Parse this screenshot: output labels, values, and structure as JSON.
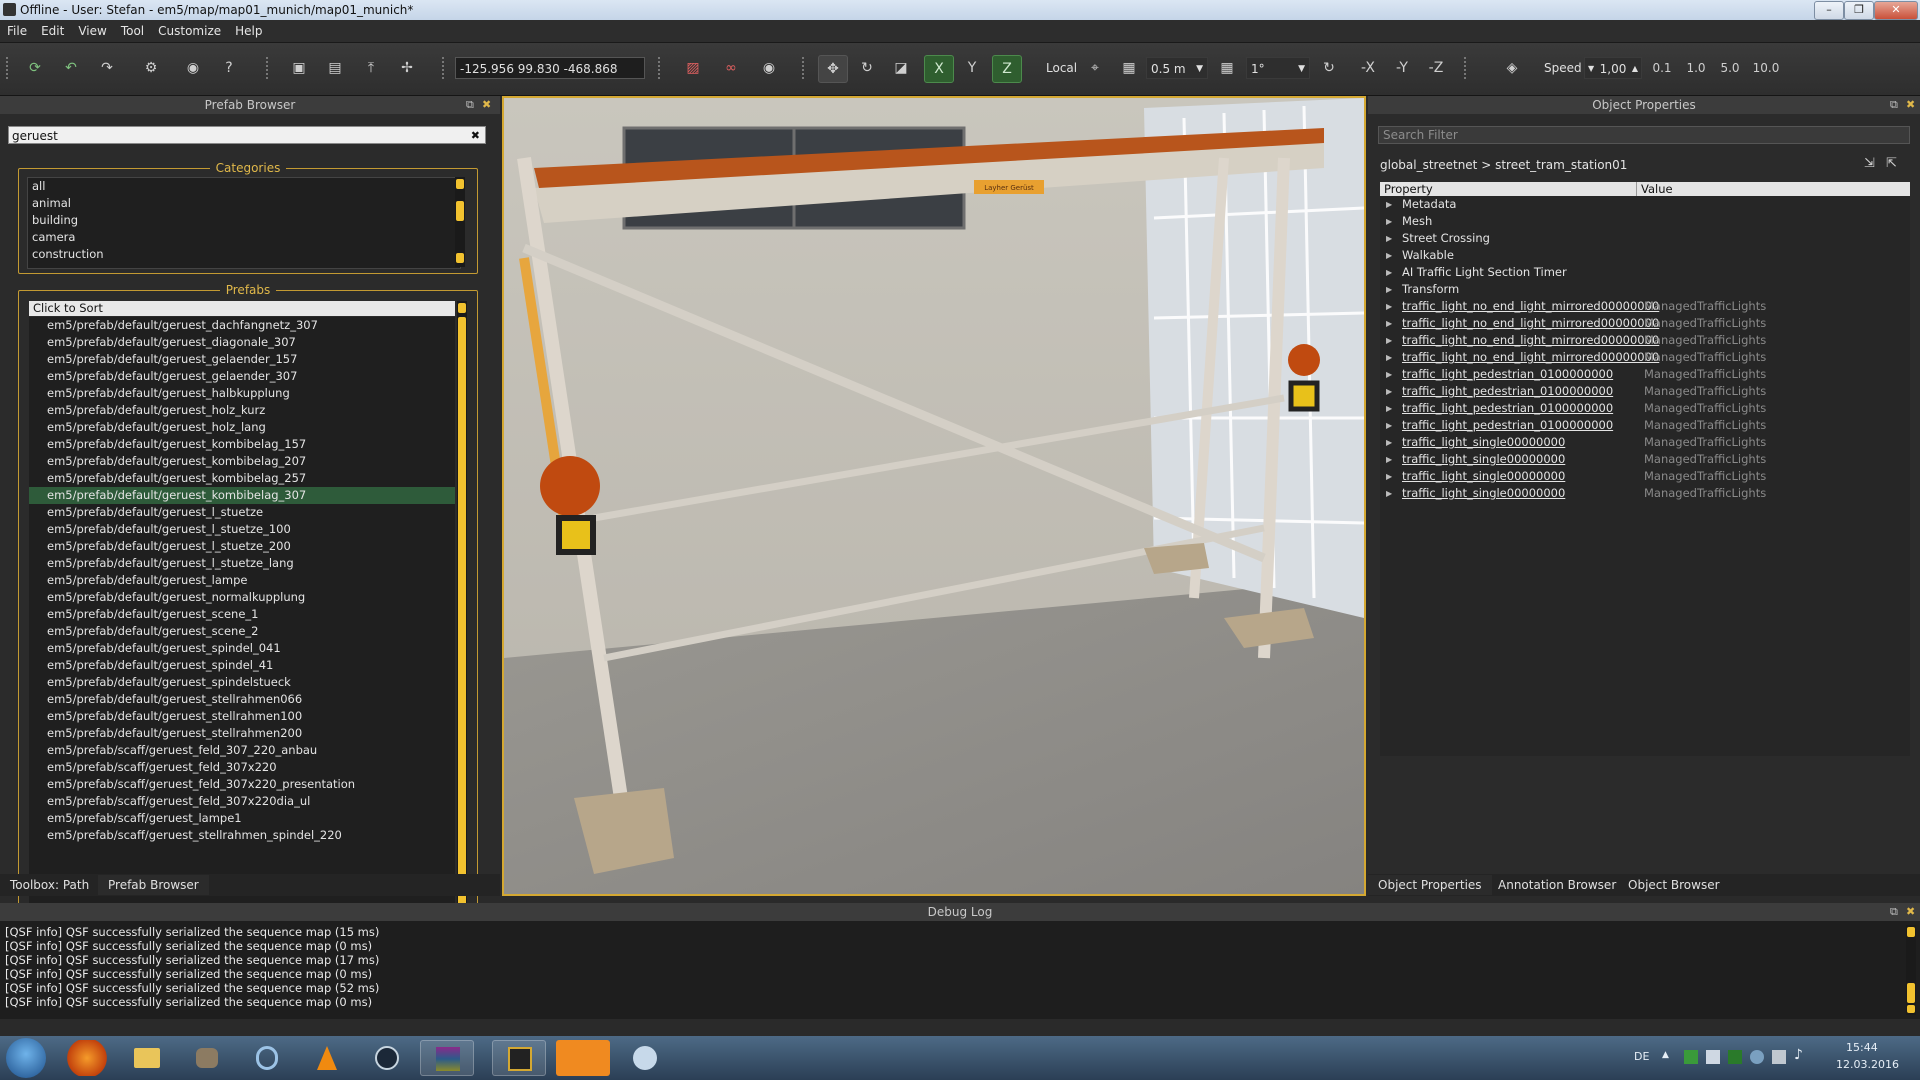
{
  "window": {
    "title": "Offline - User: Stefan - em5/map/map01_munich/map01_munich*",
    "min": "–",
    "max": "❐",
    "close": "✕"
  },
  "menu": [
    "File",
    "Edit",
    "View",
    "Tool",
    "Customize",
    "Help"
  ],
  "toolbar": {
    "coords": "-125.956 99.830 -468.868",
    "axis_x": "X",
    "axis_y": "Y",
    "axis_z": "Z",
    "local_label": "Local",
    "grid_size": "0.5 m",
    "angle_snap": "1°",
    "neg_x": "-X",
    "neg_y": "-Y",
    "neg_z": "-Z",
    "speed_label": "Speed",
    "speed_value": "1,00",
    "speed_presets": [
      "0.1",
      "1.0",
      "5.0",
      "10.0"
    ]
  },
  "prefab_browser": {
    "header": "Prefab Browser",
    "search_value": "geruest",
    "categories_title": "Categories",
    "categories": [
      "all",
      "animal",
      "building",
      "camera",
      "construction"
    ],
    "prefabs_title": "Prefabs",
    "sort_label": "Click to Sort",
    "selected_index": 10,
    "prefabs": [
      "em5/prefab/default/geruest_dachfangnetz_307",
      "em5/prefab/default/geruest_diagonale_307",
      "em5/prefab/default/geruest_gelaender_157",
      "em5/prefab/default/geruest_gelaender_307",
      "em5/prefab/default/geruest_halbkupplung",
      "em5/prefab/default/geruest_holz_kurz",
      "em5/prefab/default/geruest_holz_lang",
      "em5/prefab/default/geruest_kombibelag_157",
      "em5/prefab/default/geruest_kombibelag_207",
      "em5/prefab/default/geruest_kombibelag_257",
      "em5/prefab/default/geruest_kombibelag_307",
      "em5/prefab/default/geruest_l_stuetze",
      "em5/prefab/default/geruest_l_stuetze_100",
      "em5/prefab/default/geruest_l_stuetze_200",
      "em5/prefab/default/geruest_l_stuetze_lang",
      "em5/prefab/default/geruest_lampe",
      "em5/prefab/default/geruest_normalkupplung",
      "em5/prefab/default/geruest_scene_1",
      "em5/prefab/default/geruest_scene_2",
      "em5/prefab/default/geruest_spindel_041",
      "em5/prefab/default/geruest_spindel_41",
      "em5/prefab/default/geruest_spindelstueck",
      "em5/prefab/default/geruest_stellrahmen066",
      "em5/prefab/default/geruest_stellrahmen100",
      "em5/prefab/default/geruest_stellrahmen200",
      "em5/prefab/scaff/geruest_feld_307_220_anbau",
      "em5/prefab/scaff/geruest_feld_307x220",
      "em5/prefab/scaff/geruest_feld_307x220_presentation",
      "em5/prefab/scaff/geruest_feld_307x220dia_ul",
      "em5/prefab/scaff/geruest_lampe1",
      "em5/prefab/scaff/geruest_stellrahmen_spindel_220"
    ],
    "bottom_tabs": [
      "Toolbox: Path",
      "Prefab Browser"
    ]
  },
  "viewport": {
    "sign_text": "Layher Gerüst"
  },
  "object_properties": {
    "header": "Object Properties",
    "search_placeholder": "Search Filter",
    "breadcrumb": "global_streetnet > street_tram_station01",
    "col_property": "Property",
    "col_value": "Value",
    "groups": [
      "Metadata",
      "Mesh",
      "Street Crossing",
      "Walkable",
      "AI Traffic Light Section Timer",
      "Transform"
    ],
    "components": [
      {
        "name": "traffic_light_no_end_light_mirrored00000000",
        "value": "ManagedTrafficLights"
      },
      {
        "name": "traffic_light_no_end_light_mirrored00000000",
        "value": "ManagedTrafficLights"
      },
      {
        "name": "traffic_light_no_end_light_mirrored00000000",
        "value": "ManagedTrafficLights"
      },
      {
        "name": "traffic_light_no_end_light_mirrored00000000",
        "value": "ManagedTrafficLights"
      },
      {
        "name": "traffic_light_pedestrian_0100000000",
        "value": "ManagedTrafficLights"
      },
      {
        "name": "traffic_light_pedestrian_0100000000",
        "value": "ManagedTrafficLights"
      },
      {
        "name": "traffic_light_pedestrian_0100000000",
        "value": "ManagedTrafficLights"
      },
      {
        "name": "traffic_light_pedestrian_0100000000",
        "value": "ManagedTrafficLights"
      },
      {
        "name": "traffic_light_single00000000",
        "value": "ManagedTrafficLights"
      },
      {
        "name": "traffic_light_single00000000",
        "value": "ManagedTrafficLights"
      },
      {
        "name": "traffic_light_single00000000",
        "value": "ManagedTrafficLights"
      },
      {
        "name": "traffic_light_single00000000",
        "value": "ManagedTrafficLights"
      }
    ],
    "bottom_tabs": [
      "Object Properties",
      "Annotation Browser",
      "Object Browser"
    ]
  },
  "debug_log": {
    "header": "Debug Log",
    "lines": [
      "[QSF info] QSF successfully serialized the sequence map (15 ms)",
      "[QSF info] QSF successfully serialized the sequence map (0 ms)",
      "[QSF info] QSF successfully serialized the sequence map (17 ms)",
      "[QSF info] QSF successfully serialized the sequence map (0 ms)",
      "[QSF info] QSF successfully serialized the sequence map (52 ms)",
      "[QSF info] QSF successfully serialized the sequence map (0 ms)"
    ]
  },
  "taskbar": {
    "lang": "DE",
    "time": "15:44",
    "date": "12.03.2016",
    "apps": [
      "firefox-icon",
      "explorer-icon",
      "gimp-icon",
      "audio-icon",
      "vlc-icon",
      "steam-icon",
      "winrar-icon",
      "editor-app-icon",
      "amazon-icon",
      "paint-icon"
    ]
  },
  "colors": {
    "accent": "#d4a832",
    "selection": "#2e5b3a",
    "scroll_thumb": "#f2c22f"
  }
}
